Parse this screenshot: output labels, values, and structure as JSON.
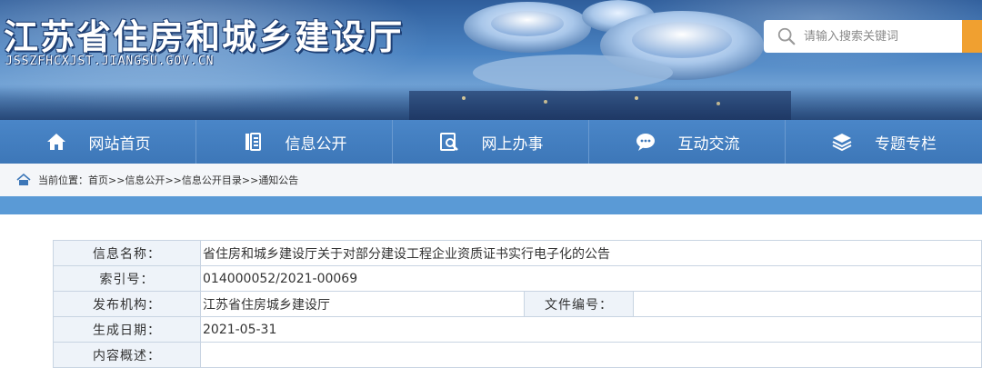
{
  "header": {
    "title": "江苏省住房和城乡建设厅",
    "url": "JSSZFHCXJST.JIANGSU.GOV.CN",
    "search_placeholder": "请输入搜索关键词"
  },
  "nav": {
    "items": [
      {
        "label": "网站首页",
        "icon": "home-icon"
      },
      {
        "label": "信息公开",
        "icon": "document-icon"
      },
      {
        "label": "网上办事",
        "icon": "search-document-icon"
      },
      {
        "label": "互动交流",
        "icon": "chat-icon"
      },
      {
        "label": "专题专栏",
        "icon": "layers-icon"
      }
    ]
  },
  "breadcrumb": {
    "prefix": "当前位置：",
    "items": [
      "首页",
      "信息公开",
      "信息公开目录",
      "通知公告"
    ],
    "separator": ">>"
  },
  "info": {
    "name_label": "信息名称：",
    "name_value": "省住房和城乡建设厅关于对部分建设工程企业资质证书实行电子化的公告",
    "index_label": "索引号：",
    "index_value": "014000052/2021-00069",
    "publisher_label": "发布机构：",
    "publisher_value": "江苏省住房城乡建设厅",
    "docno_label": "文件编号：",
    "docno_value": "",
    "date_label": "生成日期：",
    "date_value": "2021-05-31",
    "summary_label": "内容概述：",
    "summary_value": ""
  },
  "colors": {
    "nav_bg": "#3d77b8",
    "search_button": "#f0a030",
    "label_bg": "#eef3f9",
    "blue_bar": "#5a9ad6"
  }
}
